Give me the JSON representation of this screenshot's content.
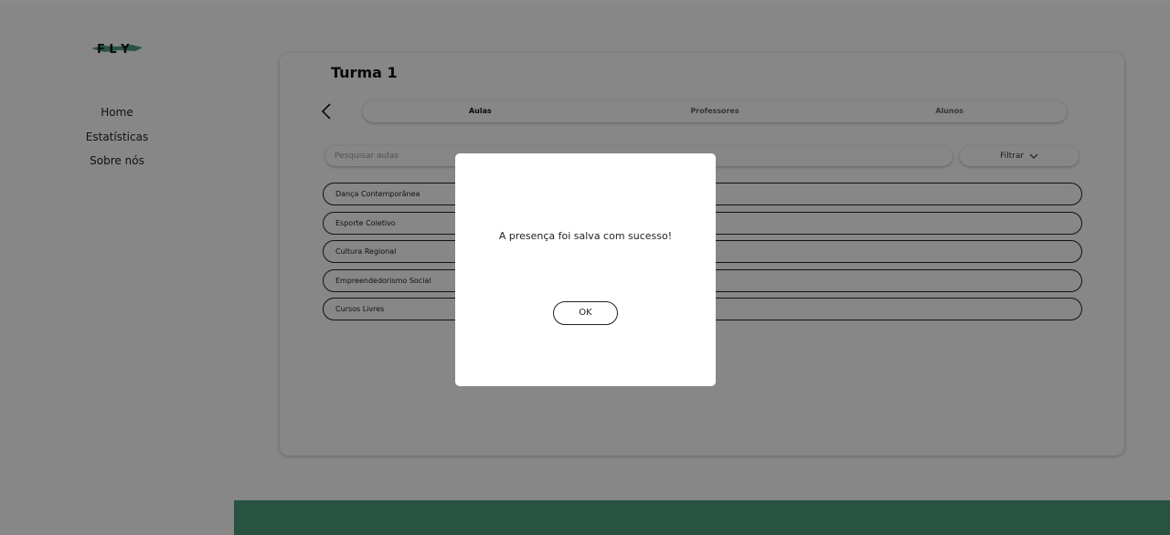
{
  "app": {
    "logo_text": "F L Y",
    "accent_color": "#4f9e7b"
  },
  "sidebar": {
    "items": [
      {
        "label": "Home"
      },
      {
        "label": "Estatísticas"
      },
      {
        "label": "Sobre nós"
      }
    ]
  },
  "main": {
    "title": "Turma 1",
    "back_icon": "chevron-left-icon",
    "tabs": [
      {
        "label": "Aulas",
        "active": true
      },
      {
        "label": "Professores",
        "active": false
      },
      {
        "label": "Alunos",
        "active": false
      }
    ],
    "search": {
      "placeholder": "Pesquisar aulas",
      "value": ""
    },
    "filter": {
      "label": "Filtrar",
      "icon": "chevron-down-icon"
    },
    "classes": [
      {
        "label": "Dança Contemporânea"
      },
      {
        "label": "Esporte Coletivo"
      },
      {
        "label": "Cultura Regional"
      },
      {
        "label": "Empreendedorismo Social"
      },
      {
        "label": "Cursos Livres"
      }
    ]
  },
  "modal": {
    "message": "A presença foi salva com sucesso!",
    "ok_label": "OK"
  }
}
